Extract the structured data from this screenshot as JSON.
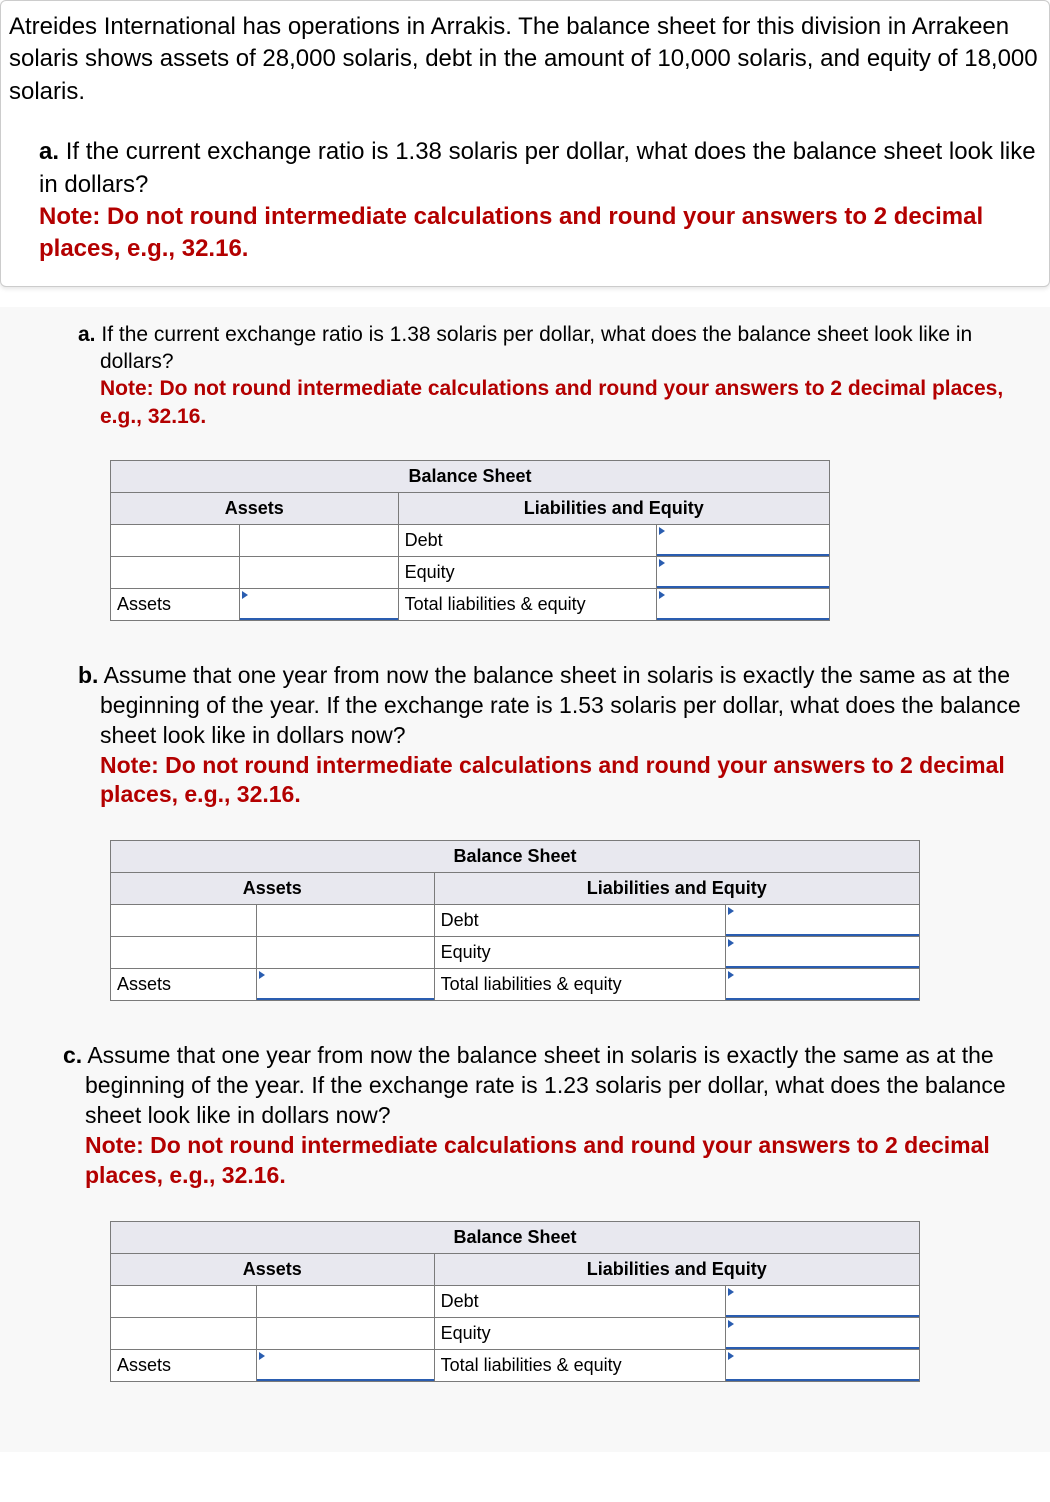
{
  "intro": "Atreides International has operations in Arrakis. The balance sheet for this division in Arrakeen solaris shows assets of 28,000 solaris, debt in the amount of 10,000 solaris, and equity of 18,000 solaris.",
  "topA": {
    "letter": "a.",
    "text": "If the current exchange ratio is 1.38 solaris per dollar, what does the balance sheet look like in dollars?",
    "note": "Note: Do not round intermediate calculations and round your answers to 2 decimal places, e.g., 32.16."
  },
  "qa": {
    "letter": "a.",
    "text": "If the current exchange ratio is 1.38 solaris per dollar, what does the balance sheet look like in dollars?",
    "note": "Note: Do not round intermediate calculations and round your answers to 2 decimal places, e.g., 32.16."
  },
  "qb": {
    "letter": "b.",
    "text": "Assume that one year from now the balance sheet in solaris is exactly the same as at the beginning of the year. If the exchange rate is 1.53 solaris per dollar, what does the balance sheet look like in dollars now?",
    "note": "Note: Do not round intermediate calculations and round your answers to 2 decimal places, e.g., 32.16."
  },
  "qc": {
    "letter": "c.",
    "text": "Assume that one year from now the balance sheet in solaris is exactly the same as at the beginning of the year. If the exchange rate is 1.23 solaris per dollar, what does the balance sheet look like in dollars now?",
    "note": "Note: Do not round intermediate calculations and round your answers to 2 decimal places, e.g., 32.16."
  },
  "tableLabels": {
    "title": "Balance Sheet",
    "assetsHeader": "Assets",
    "liabHeader": "Liabilities and Equity",
    "debt": "Debt",
    "equity": "Equity",
    "total": "Total liabilities & equity",
    "assetsRow": "Assets"
  }
}
